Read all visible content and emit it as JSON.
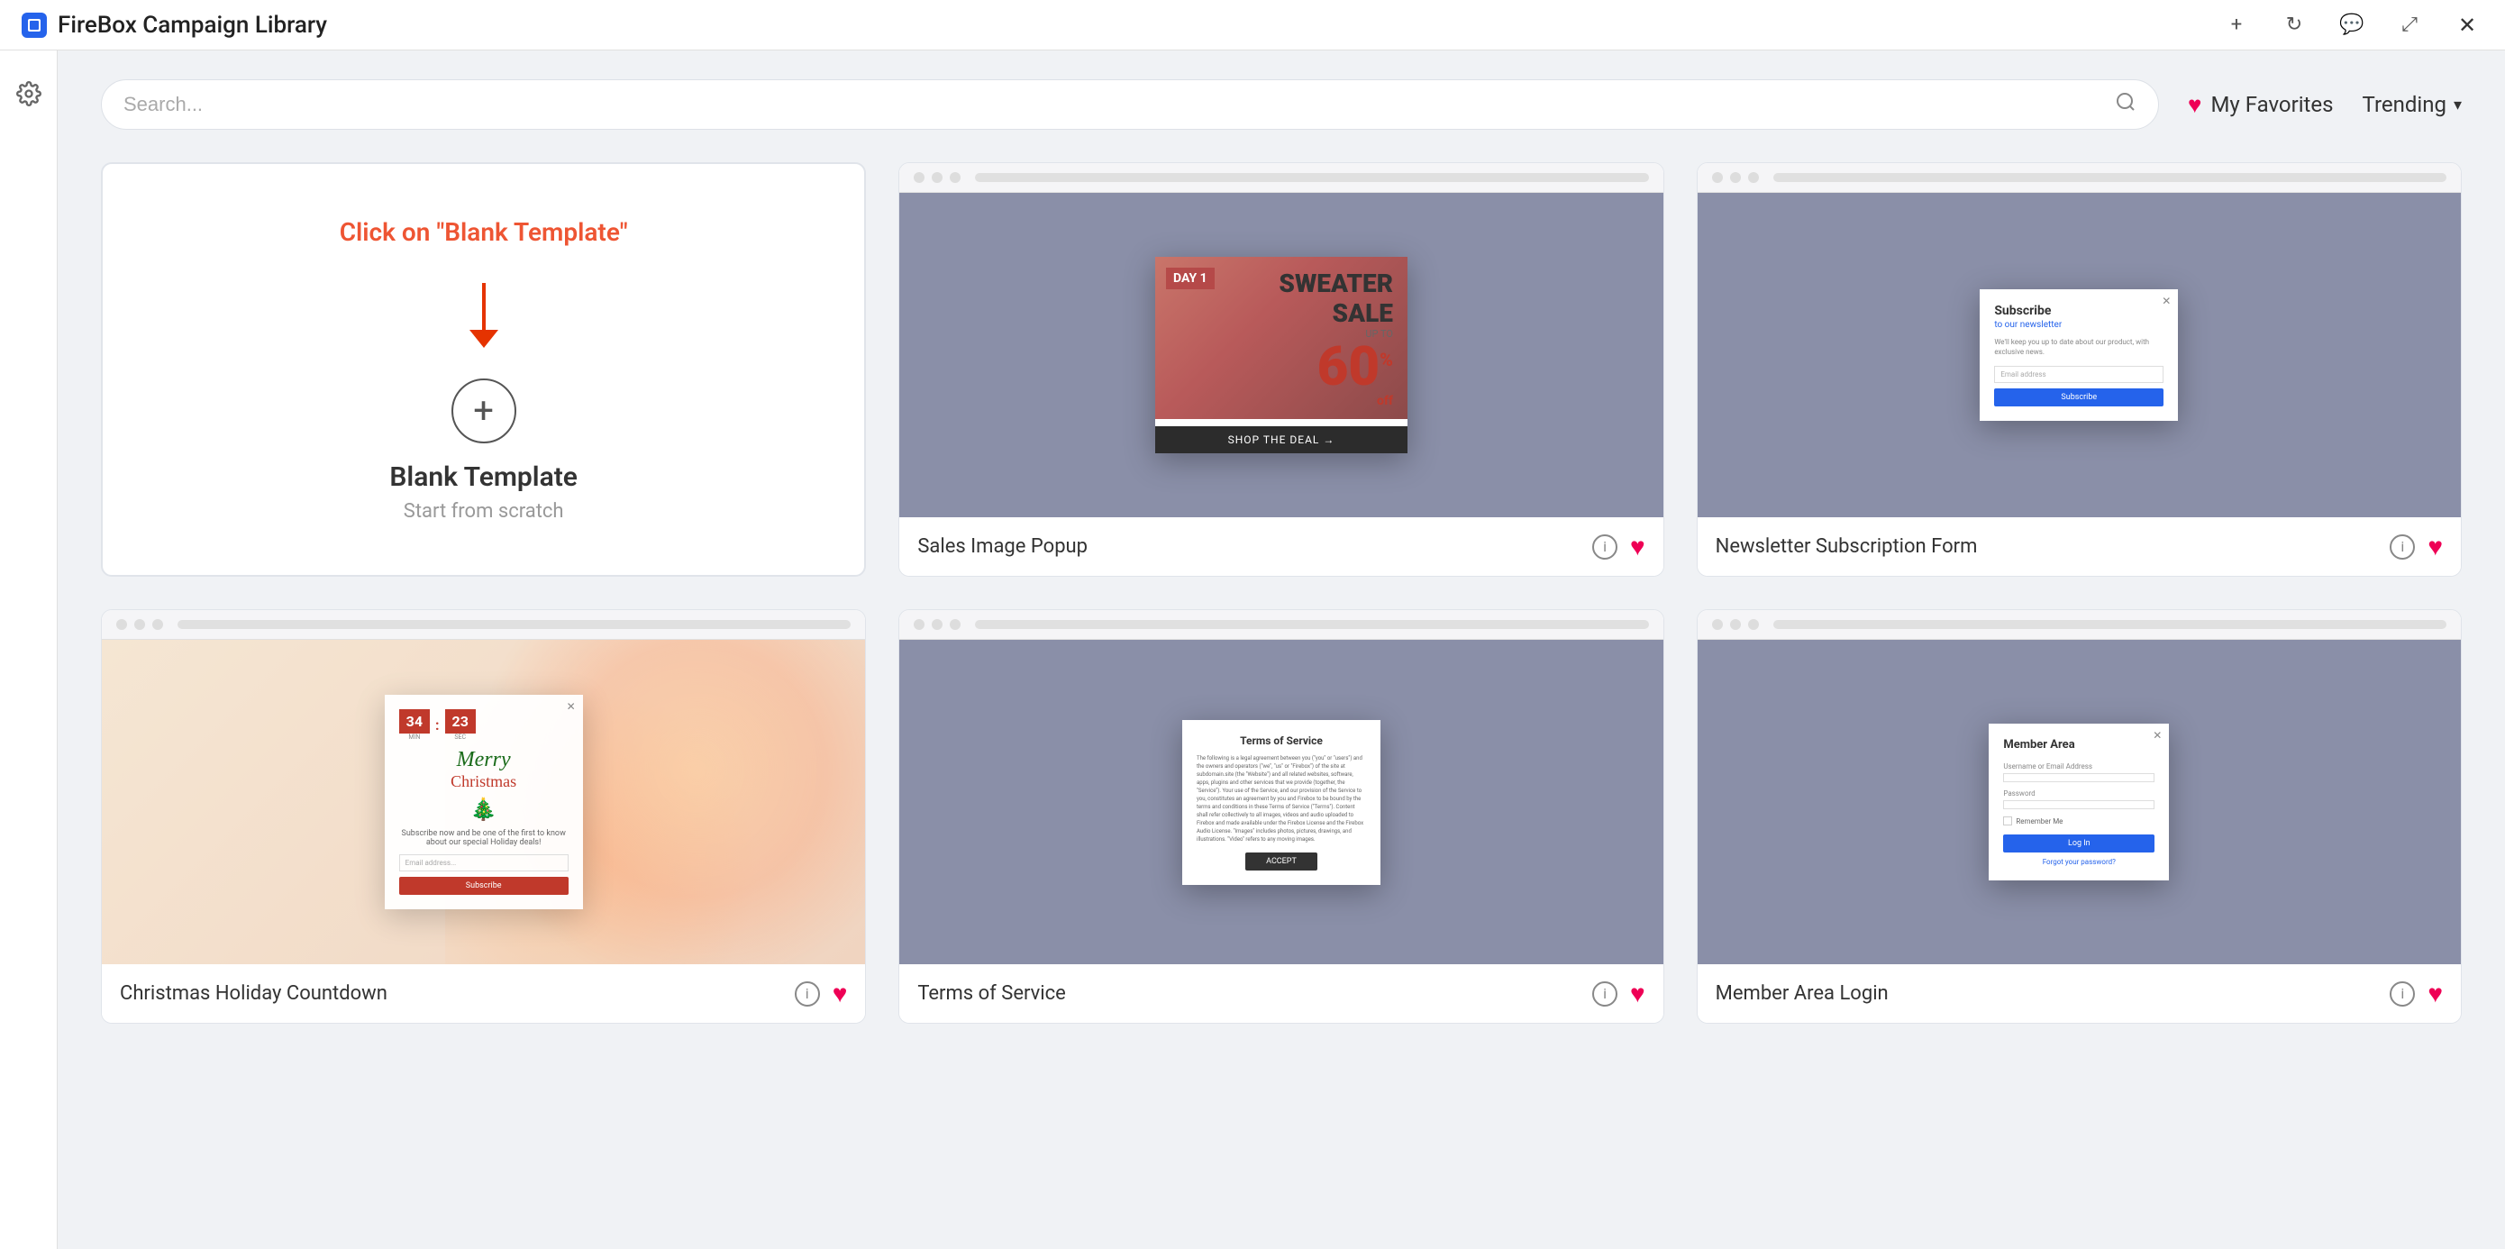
{
  "titlebar": {
    "app_name": "FireBox Campaign Library",
    "icons": {
      "add": "+",
      "refresh": "↻",
      "chat": "💬",
      "resize": "⤢",
      "close": "✕"
    }
  },
  "sidebar": {
    "icon": "⚙"
  },
  "search": {
    "placeholder": "Search..."
  },
  "topbar": {
    "favorites_label": "My Favorites",
    "trending_label": "Trending",
    "chevron": "▾"
  },
  "blank_template": {
    "instruction": "Click on \"Blank Template\"",
    "plus": "+",
    "title": "Blank Template",
    "subtitle": "Start from scratch"
  },
  "templates": [
    {
      "name": "Sales Image Popup",
      "type": "sweater"
    },
    {
      "name": "Newsletter Subscription Form",
      "type": "newsletter"
    },
    {
      "name": "Christmas Holiday Countdown",
      "type": "christmas"
    },
    {
      "name": "Terms of Service",
      "type": "tos"
    },
    {
      "name": "Member Area Login",
      "type": "member"
    }
  ],
  "colors": {
    "accent": "#2563eb",
    "heart": "#e00055",
    "red_instruction": "#e53300"
  }
}
